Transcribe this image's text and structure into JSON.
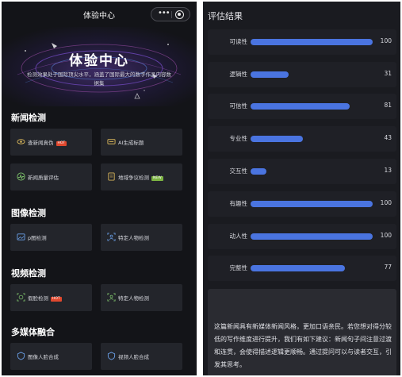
{
  "left": {
    "titlebar": {
      "title": "体验中心"
    },
    "hero": {
      "title": "体验中心",
      "subtitle": "检测效果处于国际顶尖水平，涵盖了国际最大的数字作品内容数据集"
    },
    "sections": [
      {
        "title": "新闻检测",
        "items": [
          {
            "label": "查新闻真伪",
            "icon": "eye-icon",
            "badge": "HOT"
          },
          {
            "label": "AI生成标题",
            "icon": "ai-icon",
            "badge": ""
          },
          {
            "label": "新闻质量评估",
            "icon": "pulse-icon",
            "badge": ""
          },
          {
            "label": "地域争议检测",
            "icon": "document-icon",
            "badge": "NEW"
          }
        ]
      },
      {
        "title": "图像检测",
        "items": [
          {
            "label": "p图检测",
            "icon": "image-icon",
            "badge": ""
          },
          {
            "label": "特定人物检测",
            "icon": "person-scan-icon",
            "badge": ""
          }
        ]
      },
      {
        "title": "视频检测",
        "items": [
          {
            "label": "假脸检测",
            "icon": "face-scan-icon",
            "badge": "HOT"
          },
          {
            "label": "特定人物检测",
            "icon": "person-scan-icon",
            "badge": ""
          }
        ]
      },
      {
        "title": "多媒体融合",
        "items": [
          {
            "label": "图像人脸合成",
            "icon": "shield-icon",
            "badge": ""
          },
          {
            "label": "视频人脸合成",
            "icon": "shield-icon",
            "badge": ""
          }
        ]
      }
    ]
  },
  "right": {
    "title": "评估结果",
    "metrics": [
      {
        "name": "可读性",
        "value": 100
      },
      {
        "name": "逻辑性",
        "value": 31
      },
      {
        "name": "可信性",
        "value": 81
      },
      {
        "name": "专业性",
        "value": 43
      },
      {
        "name": "交互性",
        "value": 13
      },
      {
        "name": "有趣性",
        "value": 100
      },
      {
        "name": "动人性",
        "value": 100
      },
      {
        "name": "完整性",
        "value": 77
      }
    ],
    "summary": "这篇新闻具有新媒体新闻风格，更加口语亲民。若您想对得分较低的写作维度进行提升，我们有如下建议：新闻句子间注意过渡和连贯，会使得描述逻辑更顺畅。通过提问可以与读者交互，引发其思考。",
    "accent": "#4a74e0"
  }
}
